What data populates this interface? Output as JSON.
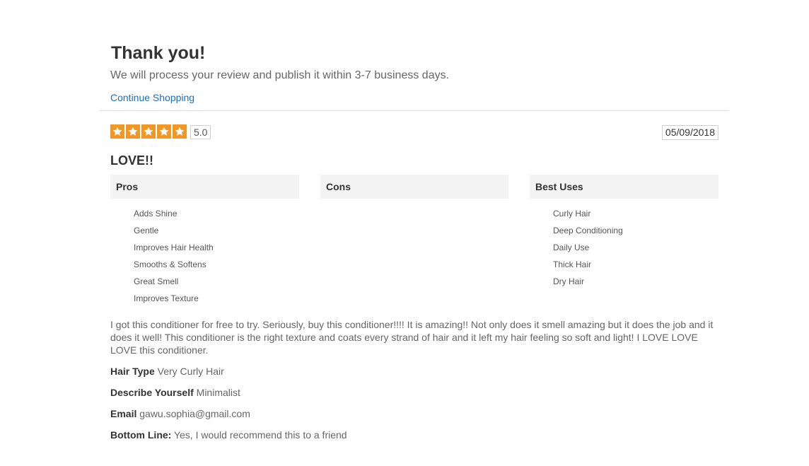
{
  "confirmation": {
    "title": "Thank you!",
    "message": "We will process your review and publish it within 3-7 business days.",
    "continue_label": "Continue Shopping"
  },
  "review": {
    "rating": 5,
    "rating_label": "5.0",
    "date": "05/09/2018",
    "title": "LOVE!!",
    "pros": {
      "heading": "Pros",
      "items": [
        "Adds Shine",
        "Gentle",
        "Improves Hair Health",
        "Smooths & Softens",
        "Great Smell",
        "Improves Texture"
      ]
    },
    "cons": {
      "heading": "Cons",
      "items": []
    },
    "best_uses": {
      "heading": "Best Uses",
      "items": [
        "Curly Hair",
        "Deep Conditioning",
        "Daily Use",
        "Thick Hair",
        "Dry Hair"
      ]
    },
    "body": "I got this conditioner for free to try. Seriously, buy this conditioner!!!! It is amazing!! Not only does it smell amazing but it does the job and it does it well! This conditioner is the right texture and coats every strand of hair and it left my hair feeling so soft and light! I LOVE LOVE LOVE this conditioner.",
    "details": [
      {
        "label": "Hair Type",
        "value": "Very Curly Hair"
      },
      {
        "label": "Describe Yourself",
        "value": "Minimalist"
      },
      {
        "label": "Email",
        "value": "gawu.sophia@gmail.com"
      },
      {
        "label": "Bottom Line:",
        "value": "Yes, I would recommend this to a friend"
      }
    ]
  },
  "colors": {
    "star": "#f29624",
    "link": "#1f6fb5",
    "header_bg": "#f4f4f4"
  },
  "icons": {
    "star": "star-icon"
  }
}
